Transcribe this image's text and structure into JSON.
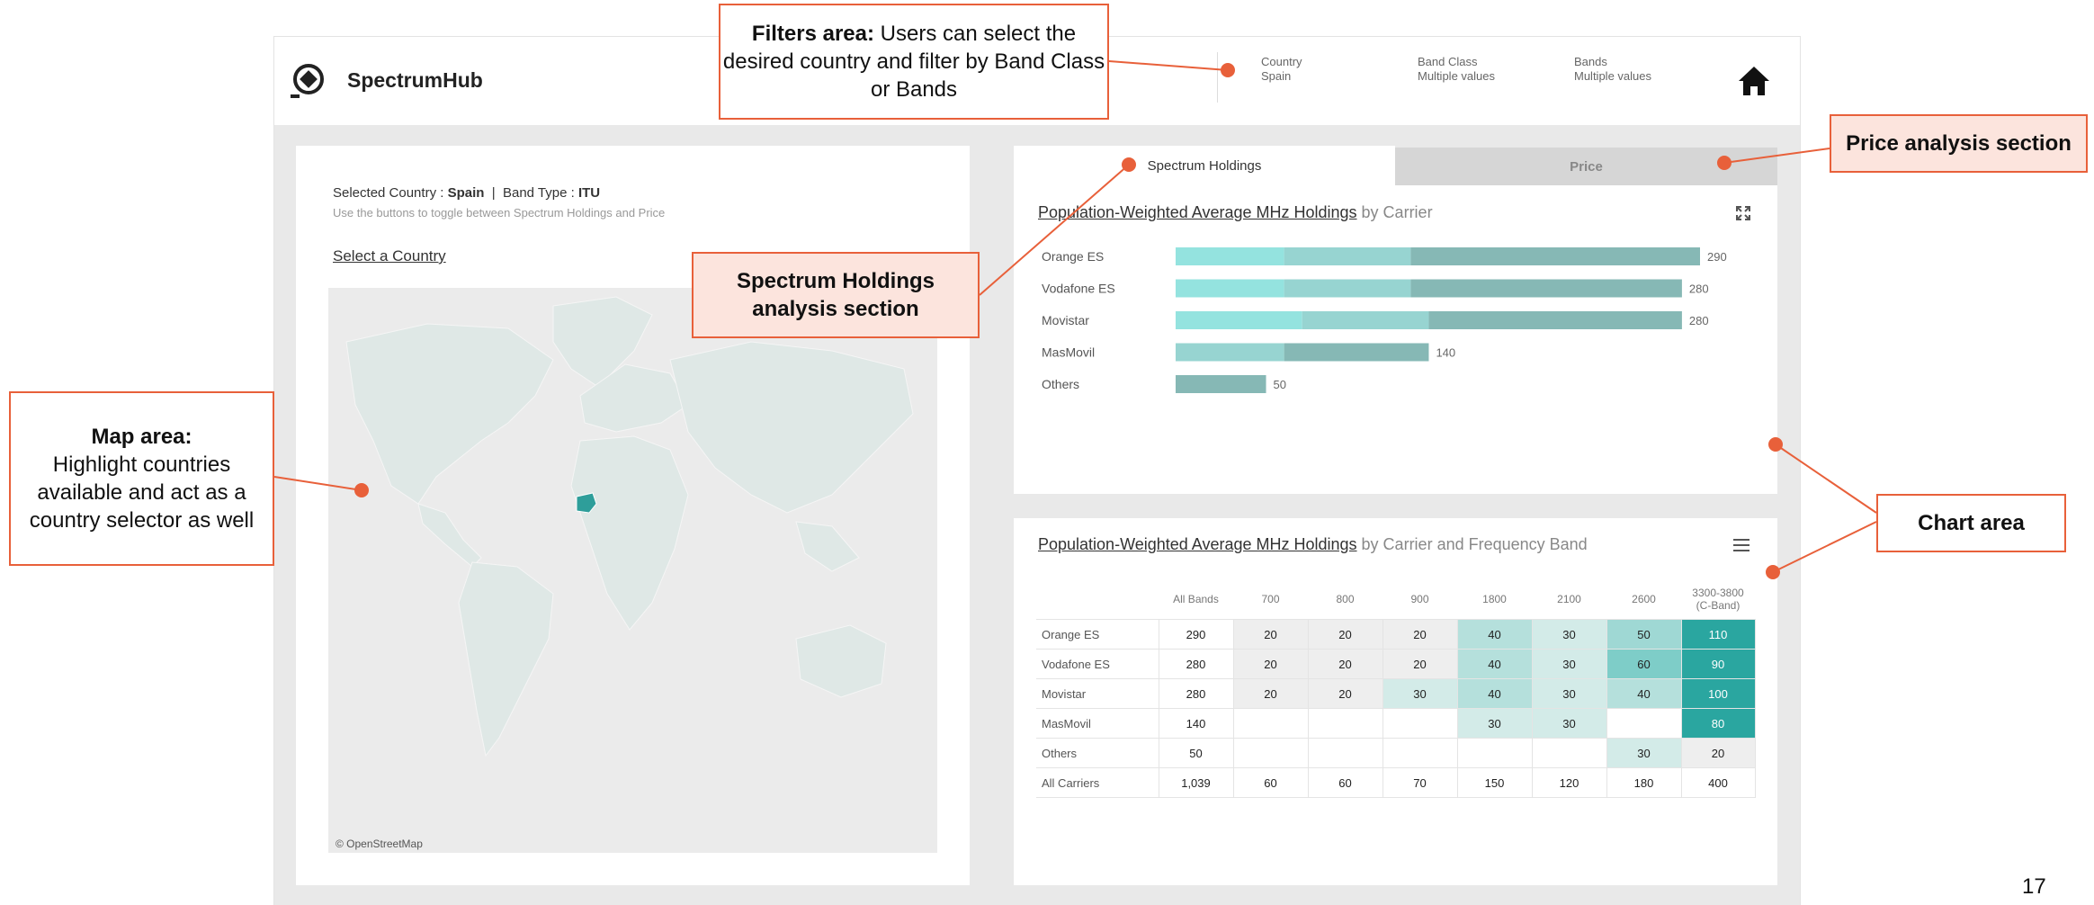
{
  "app": {
    "name": "SpectrumHub"
  },
  "filters": [
    {
      "label": "Country",
      "value": "Spain"
    },
    {
      "label": "Band Class",
      "value": "Multiple values"
    },
    {
      "label": "Bands",
      "value": "Multiple values"
    }
  ],
  "icons": {
    "logo": "spectrumhub-logo-icon",
    "home": "home-icon",
    "expand": "expand-icon",
    "menu": "menu-icon"
  },
  "map_panel": {
    "selected_prefix": "Selected Country : ",
    "selected_country": "Spain",
    "band_sep": "  |  Band Type : ",
    "band_type": "ITU",
    "help": "Use the buttons to toggle between Spectrum Holdings and Price",
    "select_link": "Select a Country",
    "attribution": "© OpenStreetMap"
  },
  "tabs": {
    "active": "Spectrum Holdings",
    "inactive": "Price"
  },
  "chart1": {
    "title_main": "Population-Weighted Average MHz Holdings",
    "title_sub": " by Carrier"
  },
  "chart2": {
    "title_main": "Population-Weighted Average MHz Holdings",
    "title_sub": " by Carrier and Frequency Band"
  },
  "chart_data": [
    {
      "type": "bar",
      "orientation": "horizontal",
      "stacked": true,
      "categories": [
        "Orange ES",
        "Vodafone ES",
        "Movistar",
        "MasMovil",
        "Others"
      ],
      "totals": [
        290,
        280,
        280,
        140,
        50
      ],
      "segments": [
        {
          "values": [
            60,
            60,
            70,
            0,
            0
          ],
          "color": "#94e3df"
        },
        {
          "values": [
            70,
            70,
            70,
            60,
            0
          ],
          "color": "#97d4d1"
        },
        {
          "values": [
            160,
            150,
            140,
            80,
            50
          ],
          "color": "#86b8b5"
        }
      ],
      "xlim": [
        0,
        290
      ]
    },
    {
      "type": "table",
      "columns": [
        "All Bands",
        "700",
        "800",
        "900",
        "1800",
        "2100",
        "2600",
        "3300-3800",
        "(C-Band)"
      ],
      "rows": [
        {
          "label": "Orange ES",
          "values": [
            "290",
            "20",
            "20",
            "20",
            "40",
            "30",
            "50",
            "110"
          ]
        },
        {
          "label": "Vodafone ES",
          "values": [
            "280",
            "20",
            "20",
            "20",
            "40",
            "30",
            "60",
            "90"
          ]
        },
        {
          "label": "Movistar",
          "values": [
            "280",
            "20",
            "20",
            "30",
            "40",
            "30",
            "40",
            "100"
          ]
        },
        {
          "label": "MasMovil",
          "values": [
            "140",
            "",
            "",
            "",
            "30",
            "30",
            "",
            "80"
          ]
        },
        {
          "label": "Others",
          "values": [
            "50",
            "",
            "",
            "",
            "",
            "",
            "30",
            "20"
          ]
        },
        {
          "label": "All Carriers",
          "values": [
            "1,039",
            "60",
            "60",
            "70",
            "150",
            "120",
            "180",
            "400"
          ]
        }
      ]
    }
  ],
  "callouts": {
    "filters_bold": "Filters area:",
    "filters_text": " Users can select the desired country and filter by Band Class or Bands",
    "price": "Price analysis section",
    "spectrum": "Spectrum Holdings analysis section",
    "map_bold": "Map area:",
    "map_text": "Highlight countries available and act as a country selector as well",
    "chart": "Chart area"
  },
  "page_number": "17"
}
